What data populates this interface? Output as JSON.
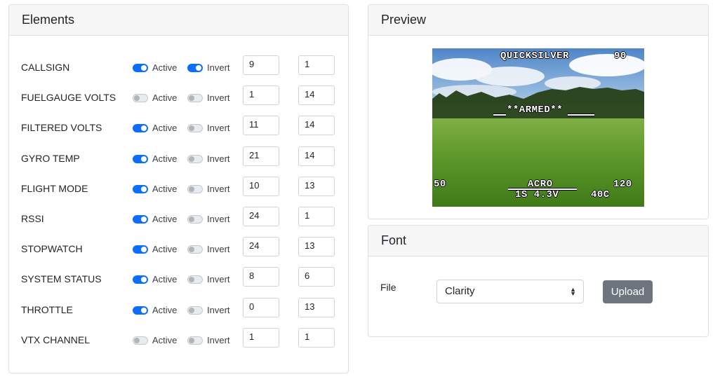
{
  "elements_panel": {
    "title": "Elements",
    "active_label": "Active",
    "invert_label": "Invert",
    "rows": [
      {
        "name": "CALLSIGN",
        "active": true,
        "invert": true,
        "x": "9",
        "y": "1"
      },
      {
        "name": "FUELGAUGE VOLTS",
        "active": false,
        "invert": false,
        "x": "1",
        "y": "14"
      },
      {
        "name": "FILTERED VOLTS",
        "active": true,
        "invert": false,
        "x": "11",
        "y": "14"
      },
      {
        "name": "GYRO TEMP",
        "active": true,
        "invert": false,
        "x": "21",
        "y": "14"
      },
      {
        "name": "FLIGHT MODE",
        "active": true,
        "invert": false,
        "x": "10",
        "y": "13"
      },
      {
        "name": "RSSI",
        "active": true,
        "invert": false,
        "x": "24",
        "y": "1"
      },
      {
        "name": "STOPWATCH",
        "active": true,
        "invert": false,
        "x": "24",
        "y": "13"
      },
      {
        "name": "SYSTEM STATUS",
        "active": true,
        "invert": false,
        "x": "8",
        "y": "6"
      },
      {
        "name": "THROTTLE",
        "active": true,
        "invert": false,
        "x": "0",
        "y": "13"
      },
      {
        "name": "VTX CHANNEL",
        "active": false,
        "invert": false,
        "x": "1",
        "y": "1"
      }
    ]
  },
  "preview_panel": {
    "title": "Preview",
    "osd": {
      "callsign": "QUICKSILVER",
      "top_right": "90",
      "status": "**ARMED**",
      "left": "50",
      "mode": "ACRO",
      "right": "120",
      "volts": "1S 4.3V",
      "temp": "40C"
    }
  },
  "font_panel": {
    "title": "Font",
    "file_label": "File",
    "selected_font": "Clarity",
    "upload_label": "Upload"
  },
  "colors": {
    "accent": "#0d6efd",
    "button_secondary": "#6c757d"
  }
}
